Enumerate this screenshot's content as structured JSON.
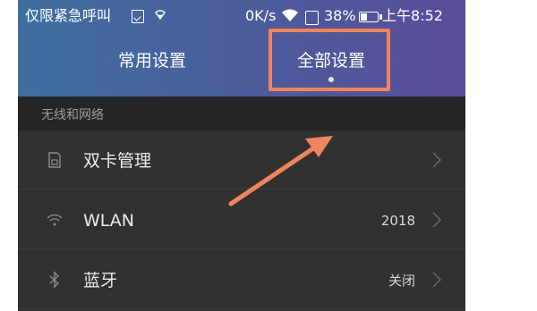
{
  "status_bar": {
    "carrier": "仅限紧急呼叫",
    "speed": "0K/s",
    "battery_percent": "38%",
    "battery_level": 0.38,
    "time": "上午8:52",
    "icons": [
      "sim-icon",
      "signal-icon",
      "wifi-icon",
      "battery-saver-icon",
      "battery-icon"
    ]
  },
  "tabs": [
    {
      "label": "常用设置",
      "active": false
    },
    {
      "label": "全部设置",
      "active": true
    }
  ],
  "annotation": {
    "highlight_color": "#f0845c"
  },
  "section": {
    "title": "无线和网络"
  },
  "rows": [
    {
      "label": "双卡管理",
      "value": "",
      "icon": "sim-card-icon"
    },
    {
      "label": "WLAN",
      "value": "2018",
      "icon": "wifi-icon"
    },
    {
      "label": "蓝牙",
      "value": "关闭",
      "icon": "bluetooth-icon"
    }
  ],
  "colors": {
    "background": "#313131",
    "header_gradient_start": "#3f6fa1",
    "header_gradient_end": "#5a4c98",
    "section_header": "#252525",
    "accent": "#f0845c"
  }
}
